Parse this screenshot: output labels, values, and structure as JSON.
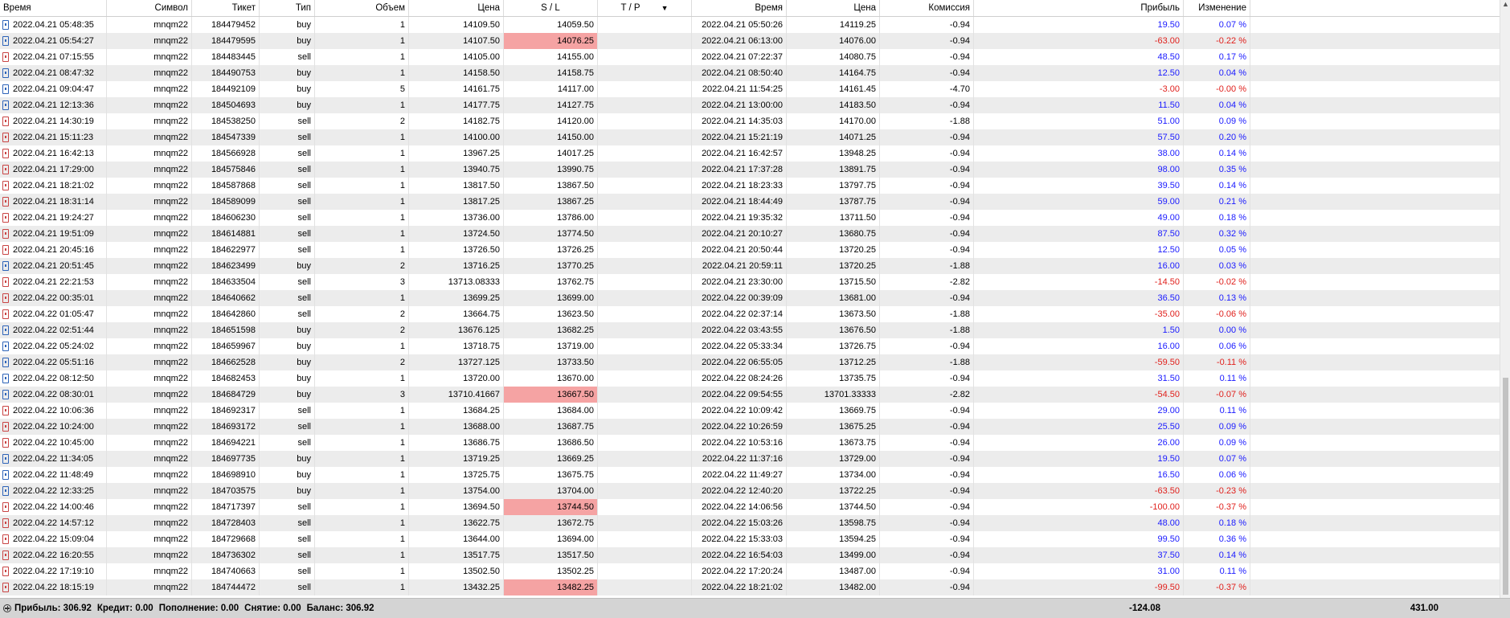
{
  "headers": {
    "time": "Время",
    "symbol": "Символ",
    "ticket": "Тикет",
    "type": "Тип",
    "volume": "Объем",
    "price": "Цена",
    "sl": "S / L",
    "tp": "T / P",
    "close_time": "Время",
    "close_price": "Цена",
    "commission": "Комиссия",
    "profit": "Прибыль",
    "change": "Изменение"
  },
  "sort_indicator": "▼",
  "rows": [
    {
      "time": "2022.04.21 05:48:35",
      "symbol": "mnqm22",
      "ticket": "184479452",
      "type": "buy",
      "volume": "1",
      "price": "14109.50",
      "sl": "14059.50",
      "tp": "",
      "close_time": "2022.04.21 05:50:26",
      "close_price": "14119.25",
      "commission": "-0.94",
      "profit": "19.50",
      "change": "0.07 %"
    },
    {
      "time": "2022.04.21 05:54:27",
      "symbol": "mnqm22",
      "ticket": "184479595",
      "type": "buy",
      "volume": "1",
      "price": "14107.50",
      "sl": "14076.25",
      "tp": "",
      "close_time": "2022.04.21 06:13:00",
      "close_price": "14076.00",
      "commission": "-0.94",
      "profit": "-63.00",
      "change": "-0.22 %"
    },
    {
      "time": "2022.04.21 07:15:55",
      "symbol": "mnqm22",
      "ticket": "184483445",
      "type": "sell",
      "volume": "1",
      "price": "14105.00",
      "sl": "14155.00",
      "tp": "",
      "close_time": "2022.04.21 07:22:37",
      "close_price": "14080.75",
      "commission": "-0.94",
      "profit": "48.50",
      "change": "0.17 %"
    },
    {
      "time": "2022.04.21 08:47:32",
      "symbol": "mnqm22",
      "ticket": "184490753",
      "type": "buy",
      "volume": "1",
      "price": "14158.50",
      "sl": "14158.75",
      "tp": "",
      "close_time": "2022.04.21 08:50:40",
      "close_price": "14164.75",
      "commission": "-0.94",
      "profit": "12.50",
      "change": "0.04 %"
    },
    {
      "time": "2022.04.21 09:04:47",
      "symbol": "mnqm22",
      "ticket": "184492109",
      "type": "buy",
      "volume": "5",
      "price": "14161.75",
      "sl": "14117.00",
      "tp": "",
      "close_time": "2022.04.21 11:54:25",
      "close_price": "14161.45",
      "commission": "-4.70",
      "profit": "-3.00",
      "change": "-0.00 %"
    },
    {
      "time": "2022.04.21 12:13:36",
      "symbol": "mnqm22",
      "ticket": "184504693",
      "type": "buy",
      "volume": "1",
      "price": "14177.75",
      "sl": "14127.75",
      "tp": "",
      "close_time": "2022.04.21 13:00:00",
      "close_price": "14183.50",
      "commission": "-0.94",
      "profit": "11.50",
      "change": "0.04 %"
    },
    {
      "time": "2022.04.21 14:30:19",
      "symbol": "mnqm22",
      "ticket": "184538250",
      "type": "sell",
      "volume": "2",
      "price": "14182.75",
      "sl": "14120.00",
      "tp": "",
      "close_time": "2022.04.21 14:35:03",
      "close_price": "14170.00",
      "commission": "-1.88",
      "profit": "51.00",
      "change": "0.09 %"
    },
    {
      "time": "2022.04.21 15:11:23",
      "symbol": "mnqm22",
      "ticket": "184547339",
      "type": "sell",
      "volume": "1",
      "price": "14100.00",
      "sl": "14150.00",
      "tp": "",
      "close_time": "2022.04.21 15:21:19",
      "close_price": "14071.25",
      "commission": "-0.94",
      "profit": "57.50",
      "change": "0.20 %"
    },
    {
      "time": "2022.04.21 16:42:13",
      "symbol": "mnqm22",
      "ticket": "184566928",
      "type": "sell",
      "volume": "1",
      "price": "13967.25",
      "sl": "14017.25",
      "tp": "",
      "close_time": "2022.04.21 16:42:57",
      "close_price": "13948.25",
      "commission": "-0.94",
      "profit": "38.00",
      "change": "0.14 %"
    },
    {
      "time": "2022.04.21 17:29:00",
      "symbol": "mnqm22",
      "ticket": "184575846",
      "type": "sell",
      "volume": "1",
      "price": "13940.75",
      "sl": "13990.75",
      "tp": "",
      "close_time": "2022.04.21 17:37:28",
      "close_price": "13891.75",
      "commission": "-0.94",
      "profit": "98.00",
      "change": "0.35 %"
    },
    {
      "time": "2022.04.21 18:21:02",
      "symbol": "mnqm22",
      "ticket": "184587868",
      "type": "sell",
      "volume": "1",
      "price": "13817.50",
      "sl": "13867.50",
      "tp": "",
      "close_time": "2022.04.21 18:23:33",
      "close_price": "13797.75",
      "commission": "-0.94",
      "profit": "39.50",
      "change": "0.14 %"
    },
    {
      "time": "2022.04.21 18:31:14",
      "symbol": "mnqm22",
      "ticket": "184589099",
      "type": "sell",
      "volume": "1",
      "price": "13817.25",
      "sl": "13867.25",
      "tp": "",
      "close_time": "2022.04.21 18:44:49",
      "close_price": "13787.75",
      "commission": "-0.94",
      "profit": "59.00",
      "change": "0.21 %"
    },
    {
      "time": "2022.04.21 19:24:27",
      "symbol": "mnqm22",
      "ticket": "184606230",
      "type": "sell",
      "volume": "1",
      "price": "13736.00",
      "sl": "13786.00",
      "tp": "",
      "close_time": "2022.04.21 19:35:32",
      "close_price": "13711.50",
      "commission": "-0.94",
      "profit": "49.00",
      "change": "0.18 %"
    },
    {
      "time": "2022.04.21 19:51:09",
      "symbol": "mnqm22",
      "ticket": "184614881",
      "type": "sell",
      "volume": "1",
      "price": "13724.50",
      "sl": "13774.50",
      "tp": "",
      "close_time": "2022.04.21 20:10:27",
      "close_price": "13680.75",
      "commission": "-0.94",
      "profit": "87.50",
      "change": "0.32 %"
    },
    {
      "time": "2022.04.21 20:45:16",
      "symbol": "mnqm22",
      "ticket": "184622977",
      "type": "sell",
      "volume": "1",
      "price": "13726.50",
      "sl": "13726.25",
      "tp": "",
      "close_time": "2022.04.21 20:50:44",
      "close_price": "13720.25",
      "commission": "-0.94",
      "profit": "12.50",
      "change": "0.05 %"
    },
    {
      "time": "2022.04.21 20:51:45",
      "symbol": "mnqm22",
      "ticket": "184623499",
      "type": "buy",
      "volume": "2",
      "price": "13716.25",
      "sl": "13770.25",
      "tp": "",
      "close_time": "2022.04.21 20:59:11",
      "close_price": "13720.25",
      "commission": "-1.88",
      "profit": "16.00",
      "change": "0.03 %"
    },
    {
      "time": "2022.04.21 22:21:53",
      "symbol": "mnqm22",
      "ticket": "184633504",
      "type": "sell",
      "volume": "3",
      "price": "13713.08333",
      "sl": "13762.75",
      "tp": "",
      "close_time": "2022.04.21 23:30:00",
      "close_price": "13715.50",
      "commission": "-2.82",
      "profit": "-14.50",
      "change": "-0.02 %"
    },
    {
      "time": "2022.04.22 00:35:01",
      "symbol": "mnqm22",
      "ticket": "184640662",
      "type": "sell",
      "volume": "1",
      "price": "13699.25",
      "sl": "13699.00",
      "tp": "",
      "close_time": "2022.04.22 00:39:09",
      "close_price": "13681.00",
      "commission": "-0.94",
      "profit": "36.50",
      "change": "0.13 %"
    },
    {
      "time": "2022.04.22 01:05:47",
      "symbol": "mnqm22",
      "ticket": "184642860",
      "type": "sell",
      "volume": "2",
      "price": "13664.75",
      "sl": "13623.50",
      "tp": "",
      "close_time": "2022.04.22 02:37:14",
      "close_price": "13673.50",
      "commission": "-1.88",
      "profit": "-35.00",
      "change": "-0.06 %"
    },
    {
      "time": "2022.04.22 02:51:44",
      "symbol": "mnqm22",
      "ticket": "184651598",
      "type": "buy",
      "volume": "2",
      "price": "13676.125",
      "sl": "13682.25",
      "tp": "",
      "close_time": "2022.04.22 03:43:55",
      "close_price": "13676.50",
      "commission": "-1.88",
      "profit": "1.50",
      "change": "0.00 %"
    },
    {
      "time": "2022.04.22 05:24:02",
      "symbol": "mnqm22",
      "ticket": "184659967",
      "type": "buy",
      "volume": "1",
      "price": "13718.75",
      "sl": "13719.00",
      "tp": "",
      "close_time": "2022.04.22 05:33:34",
      "close_price": "13726.75",
      "commission": "-0.94",
      "profit": "16.00",
      "change": "0.06 %"
    },
    {
      "time": "2022.04.22 05:51:16",
      "symbol": "mnqm22",
      "ticket": "184662528",
      "type": "buy",
      "volume": "2",
      "price": "13727.125",
      "sl": "13733.50",
      "tp": "",
      "close_time": "2022.04.22 06:55:05",
      "close_price": "13712.25",
      "commission": "-1.88",
      "profit": "-59.50",
      "change": "-0.11 %"
    },
    {
      "time": "2022.04.22 08:12:50",
      "symbol": "mnqm22",
      "ticket": "184682453",
      "type": "buy",
      "volume": "1",
      "price": "13720.00",
      "sl": "13670.00",
      "tp": "",
      "close_time": "2022.04.22 08:24:26",
      "close_price": "13735.75",
      "commission": "-0.94",
      "profit": "31.50",
      "change": "0.11 %"
    },
    {
      "time": "2022.04.22 08:30:01",
      "symbol": "mnqm22",
      "ticket": "184684729",
      "type": "buy",
      "volume": "3",
      "price": "13710.41667",
      "sl": "13667.50",
      "tp": "",
      "close_time": "2022.04.22 09:54:55",
      "close_price": "13701.33333",
      "commission": "-2.82",
      "profit": "-54.50",
      "change": "-0.07 %"
    },
    {
      "time": "2022.04.22 10:06:36",
      "symbol": "mnqm22",
      "ticket": "184692317",
      "type": "sell",
      "volume": "1",
      "price": "13684.25",
      "sl": "13684.00",
      "tp": "",
      "close_time": "2022.04.22 10:09:42",
      "close_price": "13669.75",
      "commission": "-0.94",
      "profit": "29.00",
      "change": "0.11 %"
    },
    {
      "time": "2022.04.22 10:24:00",
      "symbol": "mnqm22",
      "ticket": "184693172",
      "type": "sell",
      "volume": "1",
      "price": "13688.00",
      "sl": "13687.75",
      "tp": "",
      "close_time": "2022.04.22 10:26:59",
      "close_price": "13675.25",
      "commission": "-0.94",
      "profit": "25.50",
      "change": "0.09 %"
    },
    {
      "time": "2022.04.22 10:45:00",
      "symbol": "mnqm22",
      "ticket": "184694221",
      "type": "sell",
      "volume": "1",
      "price": "13686.75",
      "sl": "13686.50",
      "tp": "",
      "close_time": "2022.04.22 10:53:16",
      "close_price": "13673.75",
      "commission": "-0.94",
      "profit": "26.00",
      "change": "0.09 %"
    },
    {
      "time": "2022.04.22 11:34:05",
      "symbol": "mnqm22",
      "ticket": "184697735",
      "type": "buy",
      "volume": "1",
      "price": "13719.25",
      "sl": "13669.25",
      "tp": "",
      "close_time": "2022.04.22 11:37:16",
      "close_price": "13729.00",
      "commission": "-0.94",
      "profit": "19.50",
      "change": "0.07 %"
    },
    {
      "time": "2022.04.22 11:48:49",
      "symbol": "mnqm22",
      "ticket": "184698910",
      "type": "buy",
      "volume": "1",
      "price": "13725.75",
      "sl": "13675.75",
      "tp": "",
      "close_time": "2022.04.22 11:49:27",
      "close_price": "13734.00",
      "commission": "-0.94",
      "profit": "16.50",
      "change": "0.06 %"
    },
    {
      "time": "2022.04.22 12:33:25",
      "symbol": "mnqm22",
      "ticket": "184703575",
      "type": "buy",
      "volume": "1",
      "price": "13754.00",
      "sl": "13704.00",
      "tp": "",
      "close_time": "2022.04.22 12:40:20",
      "close_price": "13722.25",
      "commission": "-0.94",
      "profit": "-63.50",
      "change": "-0.23 %"
    },
    {
      "time": "2022.04.22 14:00:46",
      "symbol": "mnqm22",
      "ticket": "184717397",
      "type": "sell",
      "volume": "1",
      "price": "13694.50",
      "sl": "13744.50",
      "tp": "",
      "close_time": "2022.04.22 14:06:56",
      "close_price": "13744.50",
      "commission": "-0.94",
      "profit": "-100.00",
      "change": "-0.37 %"
    },
    {
      "time": "2022.04.22 14:57:12",
      "symbol": "mnqm22",
      "ticket": "184728403",
      "type": "sell",
      "volume": "1",
      "price": "13622.75",
      "sl": "13672.75",
      "tp": "",
      "close_time": "2022.04.22 15:03:26",
      "close_price": "13598.75",
      "commission": "-0.94",
      "profit": "48.00",
      "change": "0.18 %"
    },
    {
      "time": "2022.04.22 15:09:04",
      "symbol": "mnqm22",
      "ticket": "184729668",
      "type": "sell",
      "volume": "1",
      "price": "13644.00",
      "sl": "13694.00",
      "tp": "",
      "close_time": "2022.04.22 15:33:03",
      "close_price": "13594.25",
      "commission": "-0.94",
      "profit": "99.50",
      "change": "0.36 %"
    },
    {
      "time": "2022.04.22 16:20:55",
      "symbol": "mnqm22",
      "ticket": "184736302",
      "type": "sell",
      "volume": "1",
      "price": "13517.75",
      "sl": "13517.50",
      "tp": "",
      "close_time": "2022.04.22 16:54:03",
      "close_price": "13499.00",
      "commission": "-0.94",
      "profit": "37.50",
      "change": "0.14 %"
    },
    {
      "time": "2022.04.22 17:19:10",
      "symbol": "mnqm22",
      "ticket": "184740663",
      "type": "sell",
      "volume": "1",
      "price": "13502.50",
      "sl": "13502.25",
      "tp": "",
      "close_time": "2022.04.22 17:20:24",
      "close_price": "13487.00",
      "commission": "-0.94",
      "profit": "31.00",
      "change": "0.11 %"
    },
    {
      "time": "2022.04.22 18:15:19",
      "symbol": "mnqm22",
      "ticket": "184744472",
      "type": "sell",
      "volume": "1",
      "price": "13432.25",
      "sl": "13482.25",
      "tp": "",
      "close_time": "2022.04.22 18:21:02",
      "close_price": "13482.00",
      "commission": "-0.94",
      "profit": "-99.50",
      "change": "-0.37 %"
    }
  ],
  "sl_hit_rows": [
    1,
    23,
    30,
    35
  ],
  "colors": {
    "profit_positive": "#1a1aff",
    "profit_negative": "#e0201c",
    "sl_hit_highlight": "#f5a3a3",
    "buy_icon": "#2d63b8",
    "sell_icon": "#c94444",
    "footer_bg": "#d4d4d4",
    "alt_row_bg": "#ececec"
  },
  "footer": {
    "profit": "Прибыль: 306.92",
    "credit": "Кредит: 0.00",
    "deposit": "Пополнение: 0.00",
    "withdrawal": "Снятие: 0.00",
    "balance": "Баланс: 306.92",
    "commission_total": "-124.08",
    "profit_total": "431.00"
  },
  "icons": {
    "buy": "buy-deal-icon",
    "sell": "sell-deal-icon",
    "footer": "expand-plus-circle-icon",
    "scroll": "scroll-up-arrow-icon"
  }
}
